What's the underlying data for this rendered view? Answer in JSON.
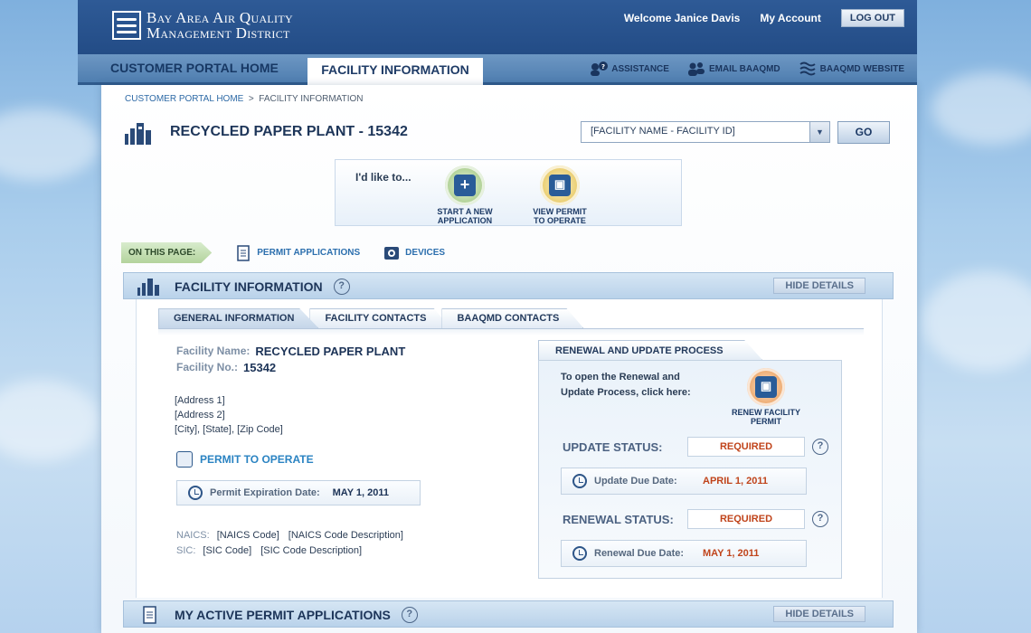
{
  "org": {
    "line1": "Bay Area Air Quality",
    "line2": "Management District"
  },
  "user": {
    "welcome": "Welcome Janice Davis",
    "account": "My Account",
    "logout": "LOG OUT"
  },
  "nav": {
    "home": "CUSTOMER PORTAL HOME",
    "active": "FACILITY INFORMATION",
    "links": [
      {
        "label": "ASSISTANCE",
        "icon": "assistance-icon"
      },
      {
        "label": "EMAIL BAAQMD",
        "icon": "people-icon"
      },
      {
        "label": "BAAQMD WEBSITE",
        "icon": "wave-icon"
      }
    ]
  },
  "breadcrumb": {
    "home": "CUSTOMER PORTAL HOME",
    "sep": ">",
    "current": "FACILITY INFORMATION"
  },
  "page": {
    "title": "RECYCLED PAPER PLANT - 15342"
  },
  "facility_select": {
    "value": "[FACILITY NAME - FACILITY ID]",
    "go": "GO"
  },
  "like": {
    "label": "I'd like to...",
    "actions": [
      {
        "label_l1": "START A NEW",
        "label_l2": "APPLICATION",
        "icon": "add-document-icon"
      },
      {
        "label_l1": "VIEW PERMIT",
        "label_l2": "TO OPERATE",
        "icon": "permit-icon"
      }
    ]
  },
  "on_this_page": {
    "tag": "ON THIS PAGE:",
    "links": [
      {
        "label": "PERMIT APPLICATIONS",
        "icon": "document-icon"
      },
      {
        "label": "DEVICES",
        "icon": "device-icon"
      }
    ]
  },
  "sections": {
    "facility": {
      "title": "FACILITY INFORMATION",
      "hide": "HIDE DETAILS"
    },
    "applications": {
      "title": "MY ACTIVE PERMIT APPLICATIONS",
      "hide": "HIDE DETAILS"
    }
  },
  "tabs": [
    "GENERAL INFORMATION",
    "FACILITY CONTACTS",
    "BAAQMD CONTACTS"
  ],
  "general": {
    "name_label": "Facility Name:",
    "name": "RECYCLED PAPER PLANT",
    "no_label": "Facility No.:",
    "no": "15342",
    "address": [
      "[Address 1]",
      "[Address 2]",
      "[City], [State], [Zip Code]"
    ],
    "pto_link": "PERMIT TO OPERATE",
    "expiration_label": "Permit Expiration Date:",
    "expiration": "MAY 1, 2011",
    "naics_label": "NAICS:",
    "naics_code": "[NAICS Code]",
    "naics_desc": "[NAICS Code Description]",
    "sic_label": "SIC:",
    "sic_code": "[SIC Code]",
    "sic_desc": "[SIC Code Description]"
  },
  "renewal": {
    "tab": "RENEWAL AND UPDATE PROCESS",
    "text_l1": "To open the Renewal and",
    "text_l2": "Update Process, click here:",
    "action_l1": "RENEW FACILITY",
    "action_l2": "PERMIT",
    "update_status_label": "UPDATE STATUS:",
    "update_status": "REQUIRED",
    "update_due_label": "Update Due Date:",
    "update_due": "APRIL 1, 2011",
    "renewal_status_label": "RENEWAL STATUS:",
    "renewal_status": "REQUIRED",
    "renewal_due_label": "Renewal Due Date:",
    "renewal_due": "MAY 1, 2011"
  },
  "colors": {
    "header": "#2e5a96",
    "nav": "#5f8bbb",
    "accent": "#2a83c2",
    "status": "#c0441b"
  }
}
